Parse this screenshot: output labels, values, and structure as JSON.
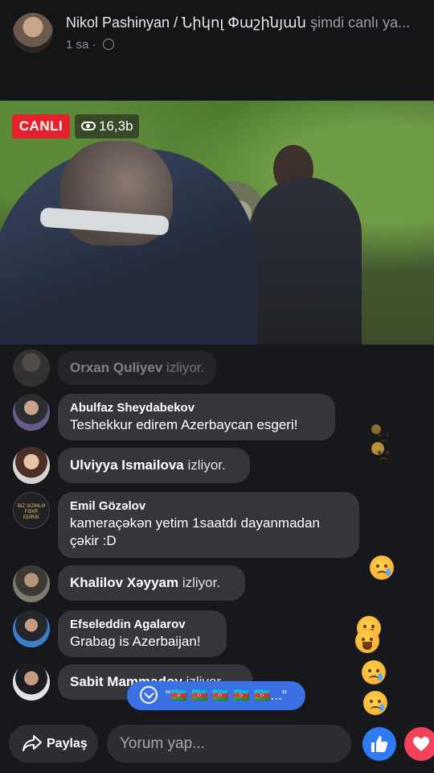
{
  "header": {
    "name": "Nikol Pashinyan / Նիկոլ Փաշինյան",
    "status": " şimdi canlı ya...",
    "time": "1 sa",
    "globe_icon": "globe-icon"
  },
  "video": {
    "live_label": "CANLI",
    "views": "16,3b"
  },
  "comments": [
    {
      "name": "Orxan Quliyev",
      "suffix": " izliyor."
    },
    {
      "name": "Abulfaz Sheydabekov",
      "text": "Teshekkur edirem Azerbaycan esgeri!"
    },
    {
      "name": "Ulviyya Ismailova",
      "suffix": " izliyor."
    },
    {
      "name": "Emil Gözəlov",
      "text": "kameraçəkən yetim  1saatdı dayanmadan çəkir :D",
      "avatar_text": "BIZ SIZINLƏ FƏXR EDİRİK"
    },
    {
      "name": "Khalilov Xəyyam",
      "suffix": " izliyor."
    },
    {
      "name": "Efseleddin Agalarov",
      "text": "Grabag is Azerbaijan!"
    },
    {
      "name": "Sabit Mammadov",
      "suffix": " izliyor."
    }
  ],
  "new_comment_pill": "\"🇦🇿 🇦🇿 🇦🇿 🇦🇿 🇦🇿...\"",
  "bottom": {
    "share_label": "Paylaş",
    "comment_placeholder": "Yorum yap..."
  },
  "colors": {
    "live_red": "#e4212c",
    "like_blue": "#2f7bf5",
    "love_red": "#f2425a",
    "pill_blue": "#3b6fe4"
  }
}
